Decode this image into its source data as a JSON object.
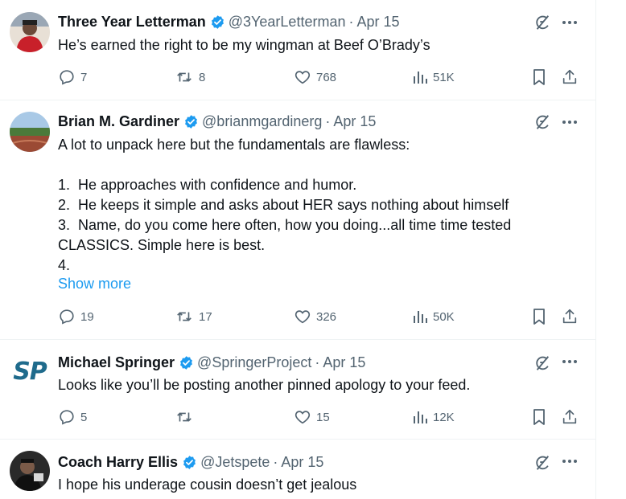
{
  "tweets": [
    {
      "name": "Three Year Letterman",
      "handle": "@3YearLetterman",
      "sep": "·",
      "date": "Apr 15",
      "text": "He’s earned the right to be my wingman at Beef O’Brady’s",
      "show_more": "",
      "replies": "7",
      "reposts": "8",
      "likes": "768",
      "views": "51K"
    },
    {
      "name": "Brian M. Gardiner",
      "handle": "@brianmgardinerg",
      "sep": "·",
      "date": "Apr 15",
      "text": "A lot to unpack here but the fundamentals are flawless:\n\n1.  He approaches with confidence and humor.\n2.  He keeps it simple and asks about HER says nothing about himself\n3.  Name, do you come here often, how you doing...all time time tested CLASSICS. Simple here is best.\n4.",
      "show_more": "Show more",
      "replies": "19",
      "reposts": "17",
      "likes": "326",
      "views": "50K"
    },
    {
      "name": "Michael Springer",
      "handle": "@SpringerProject",
      "sep": "·",
      "date": "Apr 15",
      "text": "Looks like you’ll be posting another pinned apology to your feed.",
      "show_more": "",
      "replies": "5",
      "reposts": "",
      "likes": "15",
      "views": "12K",
      "avatar_text": "SP"
    },
    {
      "name": "Coach Harry Ellis",
      "handle": "@Jetspete",
      "sep": "·",
      "date": "Apr 15",
      "text": "I hope his underage cousin doesn’t get jealous",
      "show_more": ""
    }
  ],
  "colors": {
    "verified": "#1d9bf0",
    "link": "#1d9bf0",
    "muted": "#536471",
    "sp_logo": "#1f6b8c"
  },
  "icons": [
    "verified-badge-icon",
    "grok-icon",
    "more-icon",
    "reply-icon",
    "repost-icon",
    "like-icon",
    "views-icon",
    "bookmark-icon",
    "share-icon"
  ]
}
